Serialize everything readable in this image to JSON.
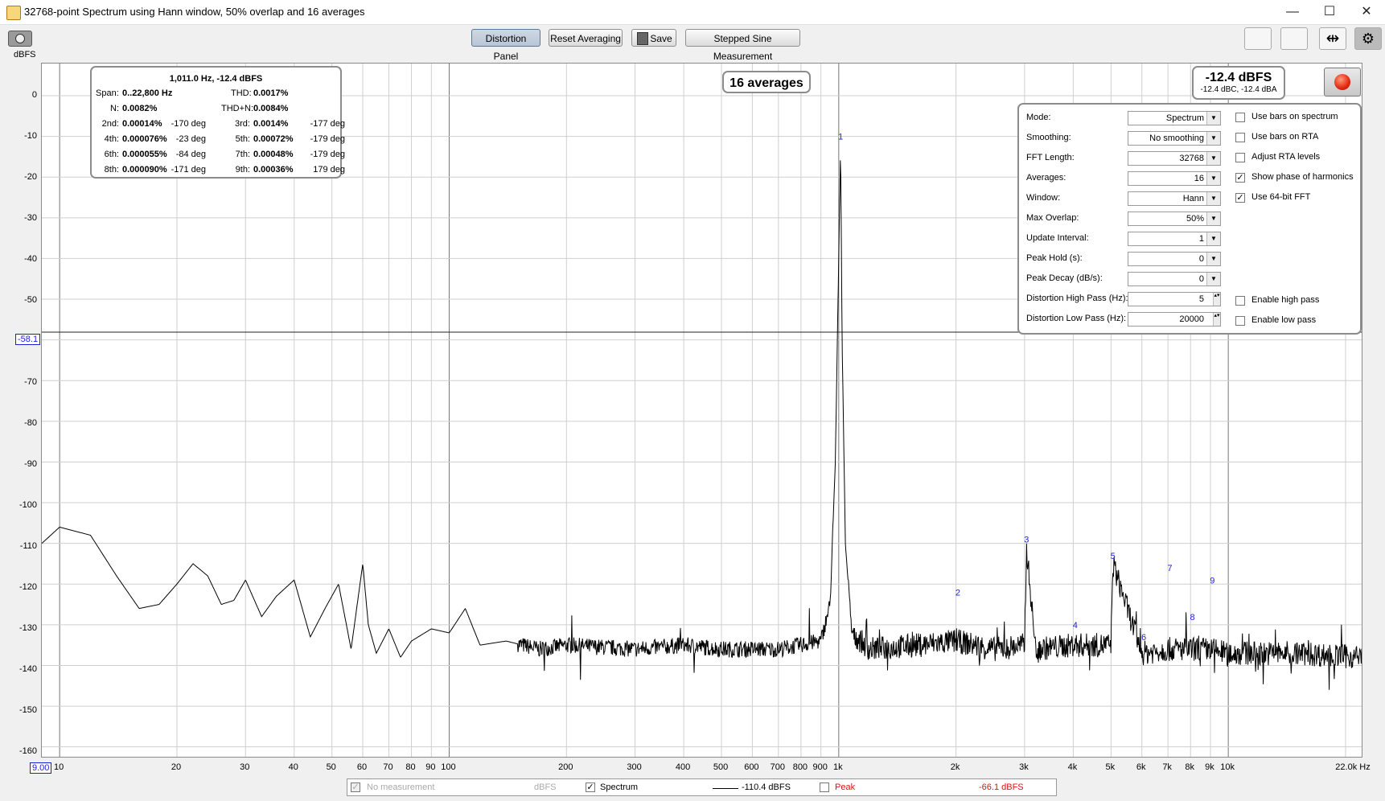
{
  "window": {
    "title": "32768-point Spectrum using Hann window, 50% overlap and 16 averages",
    "minimize": "—",
    "maximize": "☐",
    "close": "✕"
  },
  "toolbar": {
    "distortion_panel": "Distortion Panel",
    "reset_averaging": "Reset Averaging",
    "save": "Save",
    "stepped_sine": "Stepped Sine Measurement"
  },
  "y_unit": "dBFS",
  "y_ticks": [
    "0",
    "-10",
    "-20",
    "-30",
    "-40",
    "-50",
    "-60",
    "-70",
    "-80",
    "-90",
    "-100",
    "-110",
    "-120",
    "-130",
    "-140",
    "-150",
    "-160"
  ],
  "cursor_value": "-58.1",
  "x_start": "9.00",
  "x_ticks": [
    {
      "v": 10,
      "t": "10"
    },
    {
      "v": 20,
      "t": "20"
    },
    {
      "v": 30,
      "t": "30"
    },
    {
      "v": 40,
      "t": "40"
    },
    {
      "v": 50,
      "t": "50"
    },
    {
      "v": 60,
      "t": "60"
    },
    {
      "v": 70,
      "t": "70"
    },
    {
      "v": 80,
      "t": "80"
    },
    {
      "v": 90,
      "t": "90"
    },
    {
      "v": 100,
      "t": "100"
    },
    {
      "v": 200,
      "t": "200"
    },
    {
      "v": 300,
      "t": "300"
    },
    {
      "v": 400,
      "t": "400"
    },
    {
      "v": 500,
      "t": "500"
    },
    {
      "v": 600,
      "t": "600"
    },
    {
      "v": 700,
      "t": "700"
    },
    {
      "v": 800,
      "t": "800"
    },
    {
      "v": 900,
      "t": "900"
    },
    {
      "v": 1000,
      "t": "1k"
    },
    {
      "v": 2000,
      "t": "2k"
    },
    {
      "v": 3000,
      "t": "3k"
    },
    {
      "v": 4000,
      "t": "4k"
    },
    {
      "v": 5000,
      "t": "5k"
    },
    {
      "v": 6000,
      "t": "6k"
    },
    {
      "v": 7000,
      "t": "7k"
    },
    {
      "v": 8000,
      "t": "8k"
    },
    {
      "v": 9000,
      "t": "9k"
    },
    {
      "v": 10000,
      "t": "10k"
    },
    {
      "v": 22000,
      "t": "22.0k Hz"
    }
  ],
  "distortion": {
    "header": "1,011.0 Hz, -12.4 dBFS",
    "span_label": "Span:",
    "span": "0..22,800 Hz",
    "thd_label": "THD:",
    "thd": "0.0017%",
    "n_label": "N:",
    "n": "0.0082%",
    "thdn_label": "THD+N:",
    "thdn": "0.0084%",
    "harmonics": [
      {
        "label": "2nd:",
        "value": "0.00014%",
        "phase": "-170 deg"
      },
      {
        "label": "3rd:",
        "value": "0.0014%",
        "phase": "-177 deg"
      },
      {
        "label": "4th:",
        "value": "0.000076%",
        "phase": "-23 deg"
      },
      {
        "label": "5th:",
        "value": "0.00072%",
        "phase": "-179 deg"
      },
      {
        "label": "6th:",
        "value": "0.000055%",
        "phase": "-84 deg"
      },
      {
        "label": "7th:",
        "value": "0.00048%",
        "phase": "-179 deg"
      },
      {
        "label": "8th:",
        "value": "0.000090%",
        "phase": "-171 deg"
      },
      {
        "label": "9th:",
        "value": "0.00036%",
        "phase": "179 deg"
      }
    ]
  },
  "averages_badge": "16 averages",
  "level": {
    "main": "-12.4 dBFS",
    "sub": "-12.4 dBC, -12.4 dBA"
  },
  "controls": {
    "rows": [
      {
        "label": "Mode:",
        "value": "Spectrum"
      },
      {
        "label": "Smoothing:",
        "value": "No  smoothing"
      },
      {
        "label": "FFT Length:",
        "value": "32768"
      },
      {
        "label": "Averages:",
        "value": "16"
      },
      {
        "label": "Window:",
        "value": "Hann"
      },
      {
        "label": "Max Overlap:",
        "value": "50%"
      },
      {
        "label": "Update Interval:",
        "value": "1"
      },
      {
        "label": "Peak Hold (s):",
        "value": "0"
      },
      {
        "label": "Peak Decay (dB/s):",
        "value": "0"
      },
      {
        "label": "Distortion High Pass (Hz):",
        "value": "5"
      },
      {
        "label": "Distortion Low Pass (Hz):",
        "value": "20000"
      }
    ],
    "checks": [
      {
        "label": "Use bars on spectrum",
        "checked": false
      },
      {
        "label": "Use bars on RTA",
        "checked": false
      },
      {
        "label": "Adjust RTA levels",
        "checked": false
      },
      {
        "label": "Show phase of harmonics",
        "checked": true
      },
      {
        "label": "Use 64-bit FFT",
        "checked": true
      }
    ],
    "enable_high_pass": "Enable high pass",
    "enable_low_pass": "Enable low pass"
  },
  "harmonic_markers": [
    {
      "n": "1",
      "f": 1011,
      "db": -12
    },
    {
      "n": "2",
      "f": 2022,
      "db": -124
    },
    {
      "n": "3",
      "f": 3033,
      "db": -111
    },
    {
      "n": "4",
      "f": 4044,
      "db": -132
    },
    {
      "n": "5",
      "f": 5055,
      "db": -115
    },
    {
      "n": "6",
      "f": 6066,
      "db": -135
    },
    {
      "n": "7",
      "f": 7077,
      "db": -118
    },
    {
      "n": "8",
      "f": 8088,
      "db": -130
    },
    {
      "n": "9",
      "f": 9099,
      "db": -121
    }
  ],
  "legend": {
    "no_measurement": "No measurement",
    "no_measurement_unit": "dBFS",
    "spectrum": "Spectrum",
    "spectrum_value": "-110.4 dBFS",
    "peak": "Peak",
    "peak_value": "-66.1 dBFS",
    "peak_color": "#e01010"
  },
  "chart_data": {
    "type": "line",
    "x_scale": "log",
    "xlim": [
      9,
      22000
    ],
    "ylim": [
      -160,
      0
    ],
    "ylabel": "dBFS",
    "grid": true,
    "series": [
      {
        "name": "Spectrum",
        "x": [
          9,
          10,
          12,
          14,
          16,
          18,
          20,
          22,
          24,
          26,
          28,
          30,
          33,
          36,
          40,
          44,
          48,
          52,
          56,
          60,
          62,
          65,
          70,
          75,
          80,
          90,
          100,
          110,
          120,
          140,
          170,
          200,
          300,
          400,
          500,
          700,
          900,
          950,
          980,
          1000,
          1011,
          1020,
          1040,
          1080,
          1200,
          1600,
          2000,
          2500,
          3000,
          3033,
          3200,
          4000,
          5000,
          5055,
          6000,
          7000,
          8000,
          9000,
          10000,
          15000,
          22000
        ],
        "y": [
          -110,
          -106,
          -108,
          -118,
          -126,
          -125,
          -120,
          -115,
          -118,
          -125,
          -124,
          -119,
          -128,
          -123,
          -119,
          -133,
          -126,
          -120,
          -136,
          -115,
          -130,
          -137,
          -131,
          -138,
          -134,
          -131,
          -132,
          -126,
          -135,
          -134,
          -136,
          -135,
          -136,
          -135,
          -136,
          -136,
          -134,
          -125,
          -90,
          -40,
          -12,
          -60,
          -110,
          -132,
          -136,
          -135,
          -134,
          -136,
          -135,
          -111,
          -136,
          -135,
          -135,
          -115,
          -137,
          -136,
          -136,
          -136,
          -137,
          -137,
          -138
        ]
      }
    ]
  }
}
